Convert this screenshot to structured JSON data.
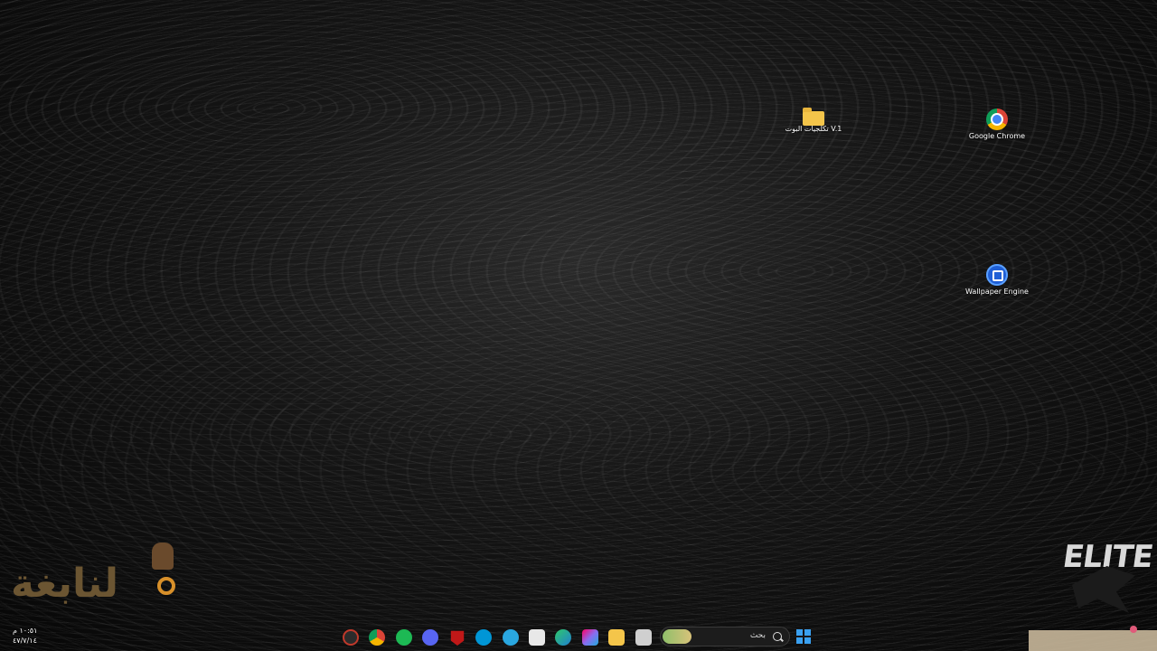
{
  "desktop": {
    "icons": [
      {
        "label": "تكلجيات البوت V.1",
        "icon": "folder-icon"
      },
      {
        "label": "Google Chrome",
        "icon": "chrome-icon"
      },
      {
        "label": "Wallpaper Engine",
        "icon": "wallpaper-engine-icon"
      }
    ]
  },
  "overlay": {
    "left_logo_text": "لنابغة",
    "right_logo_text": "ELITE"
  },
  "taskbar": {
    "time": "١٠:٥١ م",
    "date": "٤٧/٧/١٤",
    "search_label": "بحث",
    "pinned": [
      {
        "name": "clock-app-icon",
        "color": "#c0392b"
      },
      {
        "name": "chrome-icon",
        "color": "#4285f4"
      },
      {
        "name": "spotify-icon",
        "color": "#1db954"
      },
      {
        "name": "discord-icon",
        "color": "#5865f2"
      },
      {
        "name": "mcafee-icon",
        "color": "#c01818"
      },
      {
        "name": "hp-icon",
        "color": "#0096d6"
      },
      {
        "name": "help-icon",
        "color": "#2aa7e0"
      },
      {
        "name": "store-icon",
        "color": "#e8e8e8"
      },
      {
        "name": "edge-icon",
        "color": "#1fa2c7"
      },
      {
        "name": "copilot-icon",
        "color": "#8a6cf0"
      },
      {
        "name": "file-explorer-icon",
        "color": "#f4c54a"
      },
      {
        "name": "app-window-icon",
        "color": "#cfcfcf"
      }
    ]
  }
}
